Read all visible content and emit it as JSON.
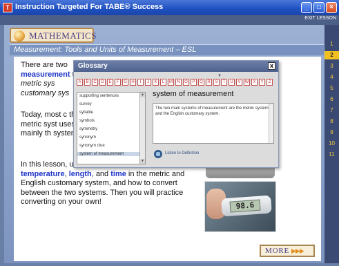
{
  "window": {
    "title": "Instruction Targeted For TABE® Success",
    "app_icon": "tabe-logo-icon",
    "minimize_icon": "minimize-icon",
    "maximize_icon": "maximize-icon",
    "close_icon": "close-icon"
  },
  "menubar": {
    "exit_label": "EXIT LESSON"
  },
  "subject": {
    "label": "MATHEMATICS"
  },
  "lesson": {
    "title": "Measurement: Tools and Units of Measurement – ESL"
  },
  "sidenav": {
    "items": [
      "1",
      "2",
      "3",
      "4",
      "5",
      "6",
      "7",
      "8",
      "9",
      "10",
      "11"
    ],
    "active": "2"
  },
  "content": {
    "p1": [
      "There are two ",
      "measurement",
      " the ",
      "metric sys",
      " ",
      "customary sys"
    ],
    "p2": "Today, most c the metric syst uses mainly th system.",
    "p3_a": "In this lesson, units of measurement for ",
    "p3_kw1": "temperature",
    "p3_b": ", ",
    "p3_kw2": "length",
    "p3_c": ", and ",
    "p3_kw3": "time",
    "p3_d": " in the metric and English customary system, and how to convert between the two systems. Then you will practice converting on your own!",
    "thermometer_reading": "98.6"
  },
  "more": {
    "label": "MORE",
    "arrows": "▶▶▶"
  },
  "glossary": {
    "title": "Glossary",
    "close_label": "x",
    "letters": [
      "A",
      "B",
      "C",
      "D",
      "E",
      "F",
      "G",
      "H",
      "I",
      "J",
      "K",
      "L",
      "M",
      "N",
      "O",
      "P",
      "Q",
      "R",
      "S",
      "T",
      "U",
      "V",
      "W",
      "X",
      "Y",
      "Z"
    ],
    "words": [
      "supporting sentences",
      "survey",
      "syllable",
      "symbols",
      "symmetry",
      "synonym",
      "synonym clue",
      "system of measurement"
    ],
    "selected_word": "system of measurement",
    "term": "system of measurement",
    "definition": "The two main systems of measurement are the metric system and the English customary system.",
    "listen_label": "Listen to Definition"
  }
}
